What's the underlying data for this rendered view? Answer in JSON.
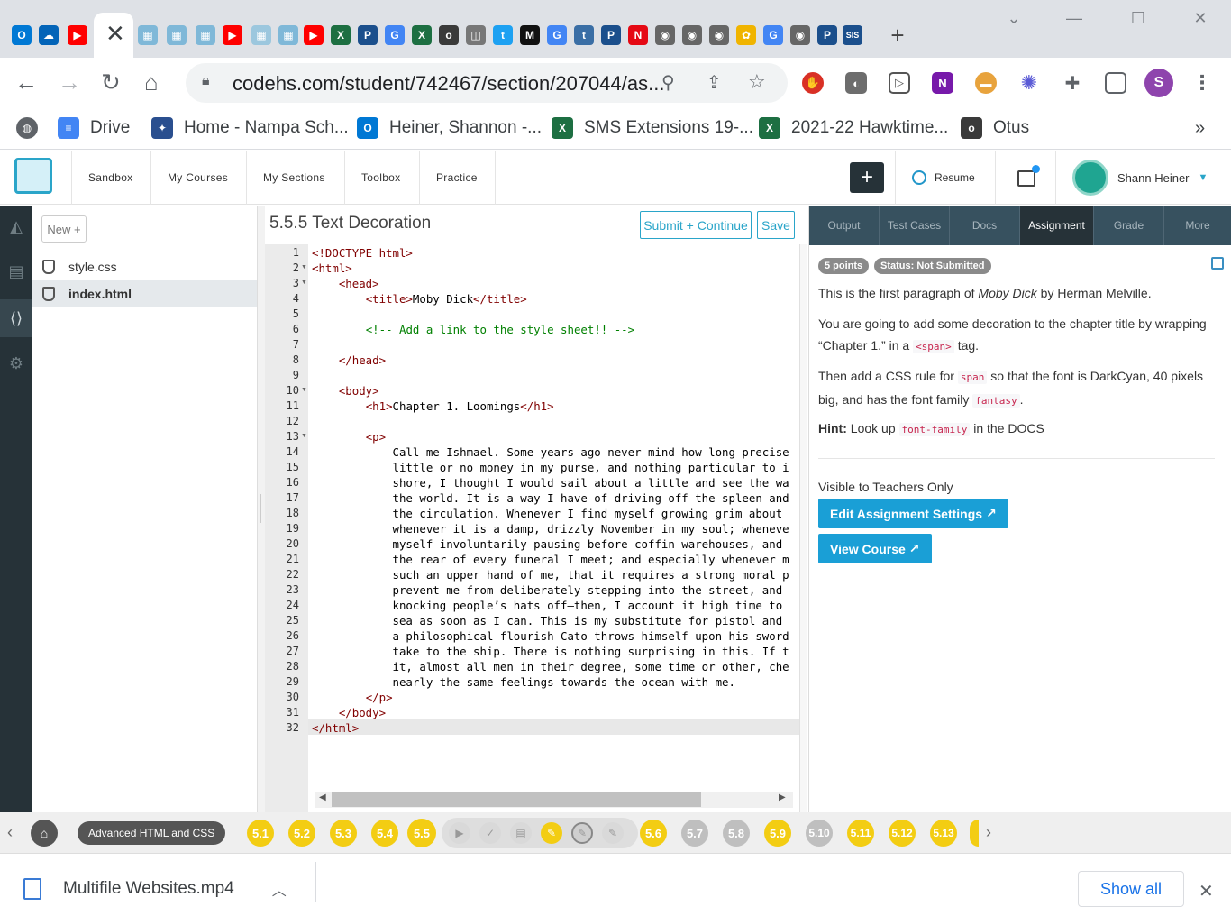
{
  "browser": {
    "tabs": [
      {
        "icon": "outlook-icon",
        "label": "O",
        "color": "#0078d4"
      },
      {
        "icon": "onedrive-icon",
        "label": "☁",
        "color": "#0364b8"
      },
      {
        "icon": "youtube-icon",
        "label": "▶",
        "color": "#ff0000"
      },
      {
        "icon": "codehs-icon",
        "label": "▦",
        "color": "#7fb8d8"
      },
      {
        "icon": "codehs-icon",
        "label": "▦",
        "color": "#7fb8d8"
      },
      {
        "icon": "codehs-icon",
        "label": "▦",
        "color": "#7fb8d8"
      },
      {
        "icon": "youtube-icon",
        "label": "▶",
        "color": "#ff0000"
      },
      {
        "icon": "codehs-icon",
        "label": "▦",
        "color": "#9cc7de"
      },
      {
        "icon": "codehs-icon",
        "label": "▦",
        "color": "#7fb8d8"
      },
      {
        "icon": "youtube-icon",
        "label": "▶",
        "color": "#ff0000"
      },
      {
        "icon": "excel-icon",
        "label": "X",
        "color": "#1d6f42"
      },
      {
        "icon": "powerschool-icon",
        "label": "P",
        "color": "#1b4f8c"
      },
      {
        "icon": "google-icon",
        "label": "G",
        "color": "#4285f4"
      },
      {
        "icon": "excel-icon",
        "label": "X",
        "color": "#1d6f42"
      },
      {
        "icon": "otus-icon",
        "label": "o",
        "color": "#3a3a3a"
      },
      {
        "icon": "cube-icon",
        "label": "◫",
        "color": "#777777"
      },
      {
        "icon": "twitter-icon",
        "label": "t",
        "color": "#1da1f2"
      },
      {
        "icon": "m-icon",
        "label": "M",
        "color": "#111111"
      },
      {
        "icon": "google-icon",
        "label": "G",
        "color": "#4285f4"
      },
      {
        "icon": "tumblr-icon",
        "label": "t",
        "color": "#3a6ea5"
      },
      {
        "icon": "powerschool-icon",
        "label": "P",
        "color": "#1b4f8c"
      },
      {
        "icon": "netflix-icon",
        "label": "N",
        "color": "#e50914"
      },
      {
        "icon": "chrome-icon",
        "label": "◉",
        "color": "#666666"
      },
      {
        "icon": "chrome-icon",
        "label": "◉",
        "color": "#666666"
      },
      {
        "icon": "chrome-icon",
        "label": "◉",
        "color": "#666666"
      },
      {
        "icon": "video-icon",
        "label": "✿",
        "color": "#f0b400"
      },
      {
        "icon": "google-icon",
        "label": "G",
        "color": "#4285f4"
      },
      {
        "icon": "chrome-icon",
        "label": "◉",
        "color": "#666666"
      },
      {
        "icon": "powerschool-icon",
        "label": "P",
        "color": "#1b4f8c"
      },
      {
        "icon": "sis-icon",
        "label": "SIS",
        "color": "#1b4f8c"
      }
    ],
    "active_tab_close": "✕",
    "new_tab": "+",
    "url": "codehs.com/student/742467/section/207044/as...",
    "profile_initial": "S",
    "bookmarks": [
      {
        "label": "Drive",
        "icon": "drive-icon",
        "glyph": "≡",
        "color": "#4285f4"
      },
      {
        "label": "Home - Nampa Sch...",
        "icon": "school-icon",
        "glyph": "✦",
        "color": "#2a4f8f"
      },
      {
        "label": "Heiner, Shannon -...",
        "icon": "outlook-icon",
        "glyph": "O",
        "color": "#0078d4"
      },
      {
        "label": "SMS Extensions 19-...",
        "icon": "excel-icon",
        "glyph": "X",
        "color": "#1d6f42"
      },
      {
        "label": "2021-22 Hawktime...",
        "icon": "excel-icon",
        "glyph": "X",
        "color": "#1d6f42"
      },
      {
        "label": "Otus",
        "icon": "otus-icon",
        "glyph": "o",
        "color": "#3a3a3a"
      }
    ],
    "more_bookmarks": "»"
  },
  "site": {
    "nav": [
      "Sandbox",
      "My Courses",
      "My Sections",
      "Toolbox",
      "Practice"
    ],
    "plus": "+",
    "resume": "Resume",
    "user": "Shann Heiner"
  },
  "files": {
    "new_label": "New +",
    "items": [
      {
        "name": "style.css",
        "selected": false
      },
      {
        "name": "index.html",
        "selected": true
      }
    ]
  },
  "editor": {
    "title": "5.5.5 Text Decoration",
    "submit": "Submit + Continue",
    "save": "Save",
    "lines": [
      "<!DOCTYPE html>",
      "<html>",
      "    <head>",
      "        <title>Moby Dick</title>",
      "",
      "        <!-- Add a link to the style sheet!! -->",
      "",
      "    </head>",
      "",
      "    <body>",
      "        <h1>Chapter 1. Loomings</h1>",
      "",
      "        <p>",
      "            Call me Ishmael. Some years ago—never mind how long precise",
      "            little or no money in my purse, and nothing particular to i",
      "            shore, I thought I would sail about a little and see the wa",
      "            the world. It is a way I have of driving off the spleen and",
      "            the circulation. Whenever I find myself growing grim about",
      "            whenever it is a damp, drizzly November in my soul; wheneve",
      "            myself involuntarily pausing before coffin warehouses, and",
      "            the rear of every funeral I meet; and especially whenever m",
      "            such an upper hand of me, that it requires a strong moral p",
      "            prevent me from deliberately stepping into the street, and",
      "            knocking people’s hats off—then, I account it high time to",
      "            sea as soon as I can. This is my substitute for pistol and",
      "            a philosophical flourish Cato throws himself upon his sword",
      "            take to the ship. There is nothing surprising in this. If t",
      "            it, almost all men in their degree, some time or other, che",
      "            nearly the same feelings towards the ocean with me.",
      "        </p>",
      "    </body>",
      "</html>"
    ],
    "folds": [
      2,
      3,
      10,
      13
    ]
  },
  "assignment": {
    "tabs": [
      "Output",
      "Test Cases",
      "Docs",
      "Assignment",
      "Grade",
      "More"
    ],
    "selected_tab": "Assignment",
    "points": "5 points",
    "status": "Status: Not Submitted",
    "p1_a": "This is the first paragraph of ",
    "p1_em": "Moby Dick",
    "p1_b": " by Herman Melville.",
    "p2_a": "You are going to add some decoration to the chapter title by wrapping “Chapter 1.” in a ",
    "p2_code": "<span>",
    "p2_b": " tag.",
    "p3_a": "Then add a CSS rule for ",
    "p3_code1": "span",
    "p3_b": " so that the font is DarkCyan, 40 pixels big, and has the font family ",
    "p3_code2": "fantasy",
    "p3_c": ".",
    "hint_label": "Hint:",
    "hint_a": " Look up ",
    "hint_code": "font-family",
    "hint_b": " in the DOCS",
    "teachers_only": "Visible to Teachers Only",
    "edit_btn": "Edit Assignment Settings",
    "view_btn": "View Course"
  },
  "progress": {
    "unit": "Advanced HTML and CSS",
    "lessons_before": [
      "5.1",
      "5.2",
      "5.3",
      "5.4",
      "5.5"
    ],
    "lessons_after": [
      {
        "label": "5.6",
        "state": "done"
      },
      {
        "label": "5.7",
        "state": "pending"
      },
      {
        "label": "5.8",
        "state": "pending"
      },
      {
        "label": "5.9",
        "state": "done"
      },
      {
        "label": "5.10",
        "state": "pending"
      },
      {
        "label": "5.11",
        "state": "done"
      },
      {
        "label": "5.12",
        "state": "done"
      },
      {
        "label": "5.13",
        "state": "done"
      }
    ],
    "subitems": [
      "video-icon",
      "check-icon",
      "doc-icon",
      "pencil-icon",
      "pencil-icon",
      "pencil-icon"
    ]
  },
  "downloads": {
    "file": "Multifile Websites.mp4",
    "show_all": "Show all",
    "close": "✕"
  }
}
